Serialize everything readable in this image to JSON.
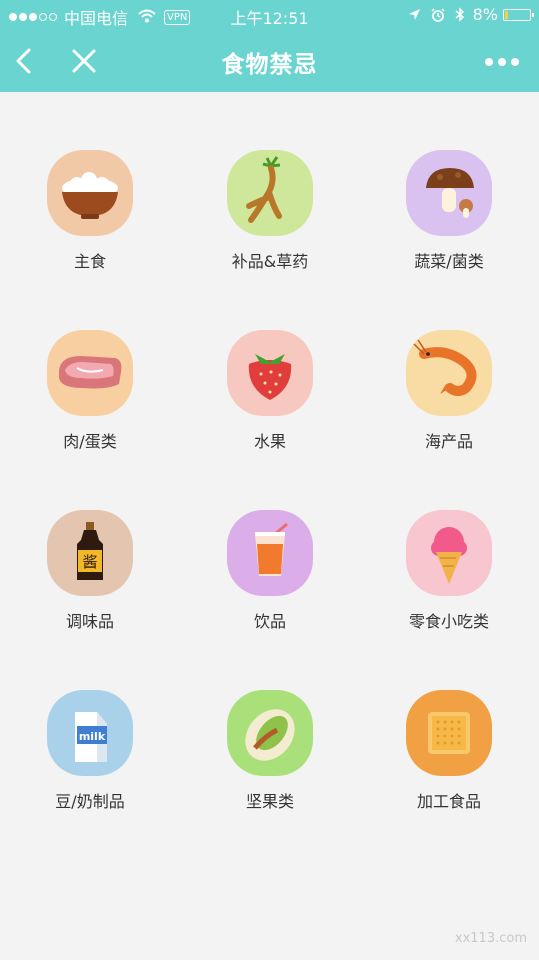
{
  "status_bar": {
    "carrier": "中国电信",
    "vpn": "VPN",
    "time": "上午12:51",
    "battery": "8%"
  },
  "nav": {
    "title": "食物禁忌"
  },
  "categories": [
    {
      "label": "主食",
      "bg": "#f2c9a6",
      "icon": "rice-bowl-icon"
    },
    {
      "label": "补品&草药",
      "bg": "#cfe79a",
      "icon": "ginseng-icon"
    },
    {
      "label": "蔬菜/菌类",
      "bg": "#d9c2ef",
      "icon": "mushroom-icon"
    },
    {
      "label": "肉/蛋类",
      "bg": "#f7cfa0",
      "icon": "meat-icon"
    },
    {
      "label": "水果",
      "bg": "#f7c8c0",
      "icon": "strawberry-icon"
    },
    {
      "label": "海产品",
      "bg": "#f9dca4",
      "icon": "shrimp-icon"
    },
    {
      "label": "调味品",
      "bg": "#e3c5b0",
      "icon": "soy-sauce-icon"
    },
    {
      "label": "饮品",
      "bg": "#dcaee9",
      "icon": "juice-icon"
    },
    {
      "label": "零食小吃类",
      "bg": "#f8c6cf",
      "icon": "ice-cream-icon"
    },
    {
      "label": "豆/奶制品",
      "bg": "#a9d1ea",
      "icon": "milk-carton-icon"
    },
    {
      "label": "坚果类",
      "bg": "#a9e07a",
      "icon": "pistachio-icon"
    },
    {
      "label": "加工食品",
      "bg": "#f1a044",
      "icon": "biscuit-icon"
    }
  ],
  "milk_text": "milk",
  "sauce_text": "酱",
  "watermark": "xx113.com"
}
